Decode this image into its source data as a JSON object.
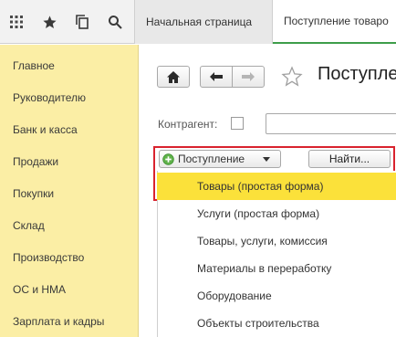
{
  "tabs": [
    {
      "label": "Начальная страница"
    },
    {
      "label": "Поступление товаро"
    }
  ],
  "sidebar": {
    "items": [
      {
        "label": "Главное"
      },
      {
        "label": "Руководителю"
      },
      {
        "label": "Банк и касса"
      },
      {
        "label": "Продажи"
      },
      {
        "label": "Покупки"
      },
      {
        "label": "Склад"
      },
      {
        "label": "Производство"
      },
      {
        "label": "ОС и НМА"
      },
      {
        "label": "Зарплата и кадры"
      }
    ]
  },
  "main": {
    "title": "Поступле",
    "counterparty_label": "Контрагент:",
    "create_dropdown_label": "Поступление",
    "find_button_label": "Найти...",
    "menu_items": [
      {
        "label": "Товары (простая форма)",
        "selected": true
      },
      {
        "label": "Услуги (простая форма)"
      },
      {
        "label": "Товары, услуги, комиссия"
      },
      {
        "label": "Материалы в переработку"
      },
      {
        "label": "Оборудование"
      },
      {
        "label": "Объекты строительства"
      }
    ]
  },
  "icons": {
    "menu": "grid-menu-icon",
    "favorites": "star-icon",
    "history": "history-icon",
    "search": "search-icon",
    "home": "home-icon",
    "back": "arrow-left-icon",
    "forward": "arrow-right-icon",
    "favorite_page": "star-outline-icon",
    "add": "plus-circle-icon",
    "dropdown": "chevron-down-icon"
  },
  "colors": {
    "sidebar_bg": "#fbeea5",
    "selected_item": "#fbe13a",
    "highlight_border": "#d9232e",
    "active_tab_underline": "#3e9d4a"
  }
}
